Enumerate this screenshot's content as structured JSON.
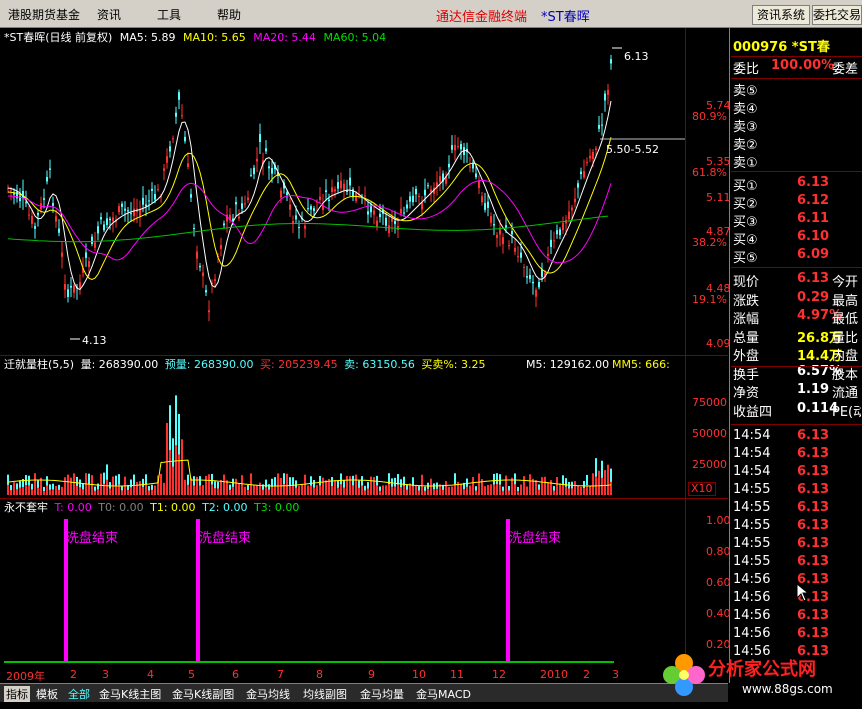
{
  "menu": {
    "items": [
      "港股期货基金",
      "资讯",
      "工具",
      "帮助"
    ],
    "brand": "通达信金融终端",
    "stock": "*ST春晖",
    "buttons": [
      "资讯系统",
      "委托交易"
    ]
  },
  "main_chart": {
    "title": "*ST春晖(日线 前复权)",
    "ma5": "MA5: 5.89",
    "ma10": "MA10: 5.65",
    "ma20": "MA20: 5.44",
    "ma60": "MA60: 5.04",
    "high_label": "6.13",
    "low_label": "4.13",
    "range_label": "5.50-5.52",
    "axis": [
      "5.74",
      "80.9%",
      "5.35",
      "61.8%",
      "5.11",
      "4.87",
      "38.2%",
      "4.48",
      "19.1%",
      "4.09"
    ]
  },
  "volume": {
    "name": "迁就量柱(5,5)",
    "vol": "量: 268390.00",
    "pred": "预量: 268390.00",
    "buy": "买: 205239.45",
    "sell": "卖: 63150.56",
    "ratio": "买卖%: 3.25",
    "m5": "M5: 129162.00",
    "mm5": "MM5: 666:",
    "axis": [
      "75000",
      "50000",
      "25000",
      "X10"
    ]
  },
  "indicator": {
    "name": "永不套牢",
    "t": "T: 0.00",
    "t0": "T0: 0.00",
    "t1": "T1: 0.00",
    "t2": "T2: 0.00",
    "t3": "T3: 0.00",
    "signal_label": "洗盘结束",
    "signals": [
      "洗盘结束",
      "洗盘结束",
      "洗盘结束"
    ],
    "axis": [
      "1.00",
      "0.80",
      "0.60",
      "0.40",
      "0.20"
    ]
  },
  "dates": [
    "2009年",
    "2",
    "3",
    "4",
    "5",
    "6",
    "7",
    "8",
    "9",
    "10",
    "11",
    "12",
    "2010",
    "2",
    "3"
  ],
  "tabs": [
    "指标",
    "模板",
    "全部",
    "金马K线主图",
    "金马K线副图",
    "金马均线",
    "均线副图",
    "金马均量",
    "金马MACD"
  ],
  "quote": {
    "code": "000976 *ST春",
    "weibi_label": "委比",
    "weibi_value": "100.00%",
    "weicha_label": "委差",
    "sells": [
      "卖⑤",
      "卖④",
      "卖③",
      "卖②",
      "卖①"
    ],
    "buys": [
      {
        "label": "买①",
        "price": "6.13"
      },
      {
        "label": "买②",
        "price": "6.12"
      },
      {
        "label": "买③",
        "price": "6.11"
      },
      {
        "label": "买④",
        "price": "6.10"
      },
      {
        "label": "买⑤",
        "price": "6.09"
      }
    ],
    "stats": [
      {
        "label": "现价",
        "value": "6.13",
        "extra": "今开",
        "color": "#ff3030"
      },
      {
        "label": "涨跌",
        "value": "0.29",
        "extra": "最高",
        "color": "#ff3030"
      },
      {
        "label": "涨幅",
        "value": "4.97%",
        "extra": "最低",
        "color": "#ff3030"
      },
      {
        "label": "总量",
        "value": "26.8万",
        "extra": "量比",
        "color": "#ffff00"
      },
      {
        "label": "外盘",
        "value": "14.4万",
        "extra": "内盘",
        "color": "#ffff00"
      },
      {
        "label": "换手",
        "value": "6.57%",
        "extra": "股本",
        "color": "#ffffff"
      },
      {
        "label": "净资",
        "value": "1.19",
        "extra": "流通",
        "color": "#ffffff"
      },
      {
        "label": "收益四",
        "value": "0.114",
        "extra": "PE(动",
        "color": "#ffffff"
      }
    ],
    "ticks": [
      {
        "time": "14:54",
        "price": "6.13"
      },
      {
        "time": "14:54",
        "price": "6.13"
      },
      {
        "time": "14:54",
        "price": "6.13"
      },
      {
        "time": "14:55",
        "price": "6.13"
      },
      {
        "time": "14:55",
        "price": "6.13"
      },
      {
        "time": "14:55",
        "price": "6.13"
      },
      {
        "time": "14:55",
        "price": "6.13"
      },
      {
        "time": "14:55",
        "price": "6.13"
      },
      {
        "time": "14:56",
        "price": "6.13"
      },
      {
        "time": "14:56",
        "price": "6.13"
      },
      {
        "time": "14:56",
        "price": "6.13"
      },
      {
        "time": "14:56",
        "price": "6.13"
      },
      {
        "time": "14:56",
        "price": "6.13"
      }
    ]
  },
  "watermark": {
    "title": "分析家公式网",
    "url": "www.88gs.com"
  },
  "colors": {
    "up": "#ff3030",
    "down": "#54ffff",
    "ma5": "#ffffff",
    "ma10": "#ffff00",
    "ma20": "#ff00ff",
    "ma60": "#00c000",
    "signal": "#ff00ff"
  }
}
